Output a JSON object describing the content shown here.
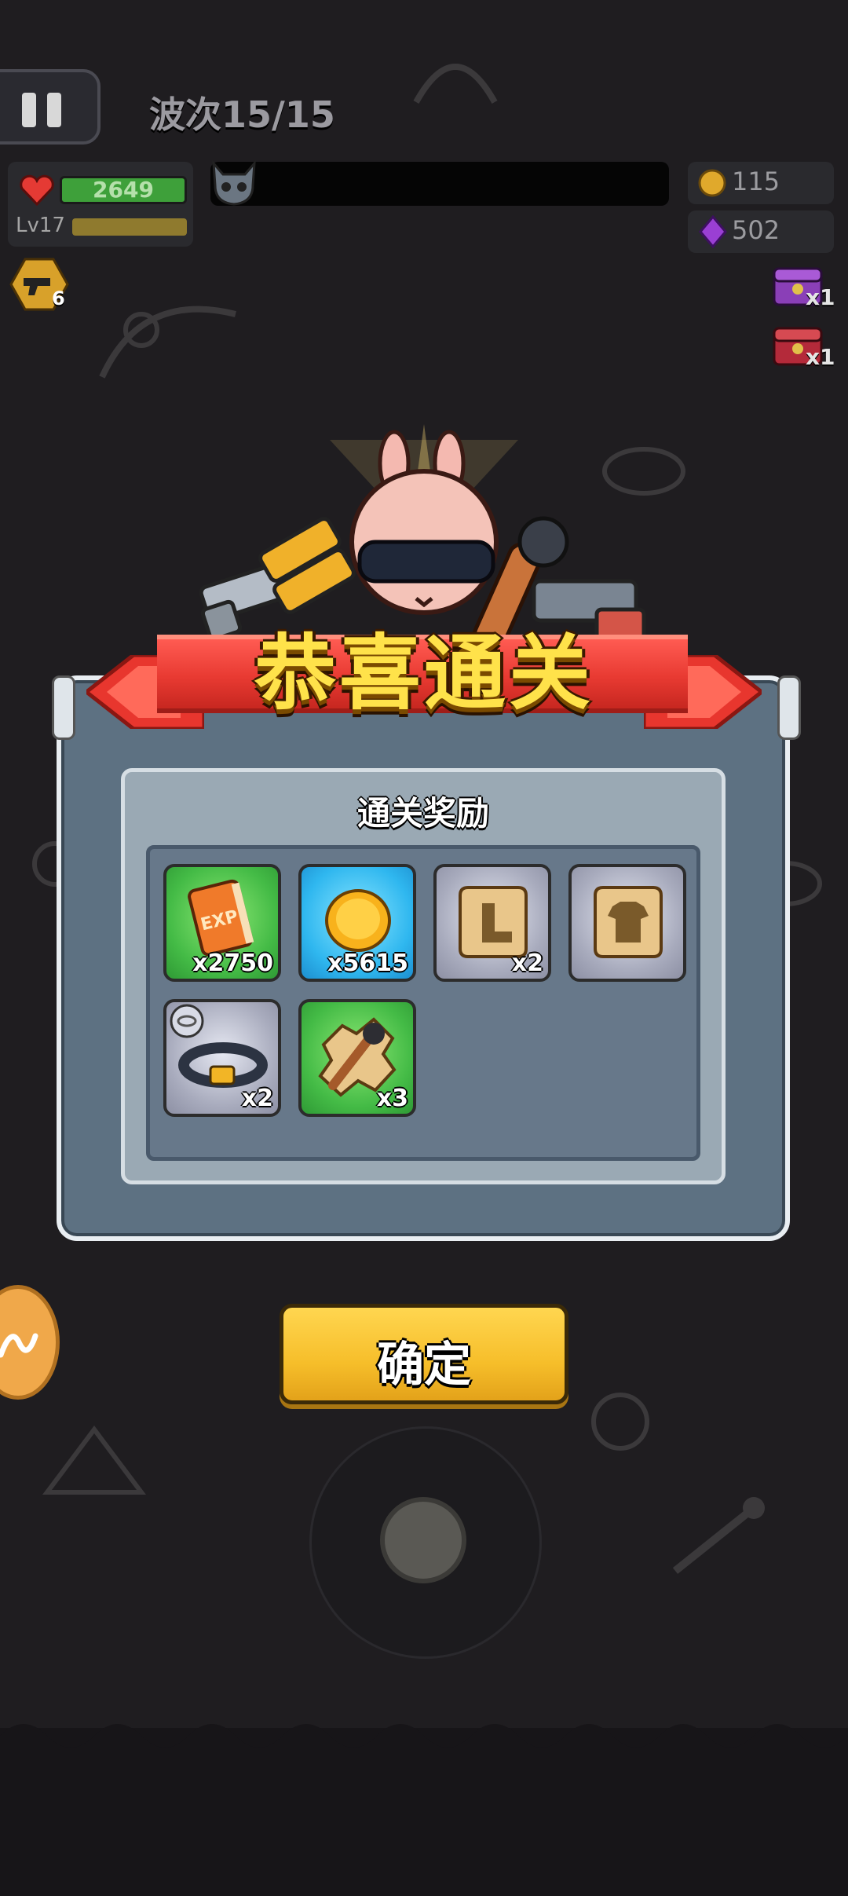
{
  "hud": {
    "wave_label": "波次15/15",
    "hp_value": "2649",
    "level_label": "Lv17",
    "weapon_count": "6",
    "gold_value": "115",
    "gem_value": "502",
    "chest_1_count": "x1",
    "chest_2_count": "x1"
  },
  "dialog": {
    "banner_title": "恭喜通关",
    "rewards_title": "通关奖励",
    "rewards": [
      {
        "icon": "exp-book-icon",
        "count": "x2750",
        "rarity": "green"
      },
      {
        "icon": "gold-coin-icon",
        "count": "x5615",
        "rarity": "blue"
      },
      {
        "icon": "boots-blueprint-icon",
        "count": "x2",
        "rarity": "grey"
      },
      {
        "icon": "armor-blueprint-icon",
        "count": "",
        "rarity": "grey"
      },
      {
        "icon": "belt-icon",
        "count": "x2",
        "rarity": "grey"
      },
      {
        "icon": "spiked-club-fragment-icon",
        "count": "x3",
        "rarity": "green"
      }
    ],
    "confirm_label": "确定"
  },
  "colors": {
    "banner_red": "#e83a32",
    "title_yellow": "#ffe24a",
    "button_yellow": "#f6be2a",
    "panel_blue_grey": "#5d7182",
    "rarity_green": "#44bb46",
    "rarity_blue": "#2fb7ef",
    "rarity_grey": "#a8abbd"
  }
}
